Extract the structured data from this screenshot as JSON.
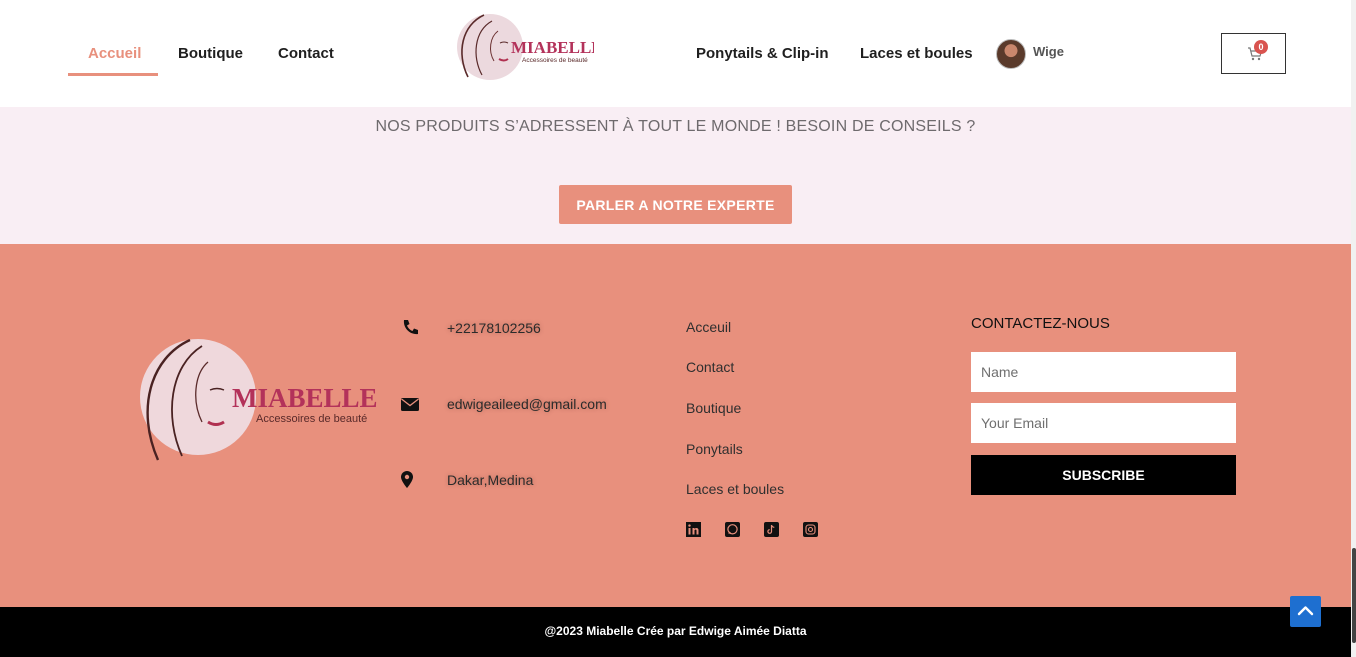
{
  "header": {
    "nav_left": [
      {
        "label": "Accueil",
        "active": true
      },
      {
        "label": "Boutique",
        "active": false
      },
      {
        "label": "Contact",
        "active": false
      }
    ],
    "logo": {
      "brand": "MIABELLE",
      "tagline": "Accessoires de beauté"
    },
    "nav_right": [
      {
        "label": "Ponytails & Clip-in"
      },
      {
        "label": "Laces et boules"
      }
    ],
    "user_name": "Wige",
    "cart_count": "0"
  },
  "band": {
    "text": "NOS PRODUITS S’ADRESSENT À TOUT LE MONDE ! BESOIN DE CONSEILS ?",
    "cta_label": "PARLER A NOTRE EXPERTE"
  },
  "footer": {
    "logo": {
      "brand": "MIABELLE",
      "tagline": "Accessoires de beauté"
    },
    "contacts": [
      {
        "icon": "phone-icon",
        "text": "+22178102256"
      },
      {
        "icon": "envelope-icon",
        "text": "edwigeaileed@gmail.com"
      },
      {
        "icon": "map-pin-icon",
        "text": "Dakar,Medina"
      }
    ],
    "links": [
      "Acceuil",
      "Contact",
      "Boutique",
      "Ponytails",
      "Laces et boules"
    ],
    "socials": [
      "linkedin-icon",
      "whatsapp-icon",
      "tiktok-icon",
      "instagram-icon"
    ],
    "form": {
      "title": "CONTACTEZ-NOUS",
      "name_placeholder": "Name",
      "email_placeholder": "Your Email",
      "submit_label": "SUBSCRIBE"
    }
  },
  "bottom": {
    "copyright": "@2023 Miabelle Crée par Edwige Aimée Diatta"
  },
  "colors": {
    "accent": "#e8907d",
    "band_bg": "#f9eef4",
    "scroll_top": "#1e6fd0",
    "logo_text": "#b3325a"
  }
}
